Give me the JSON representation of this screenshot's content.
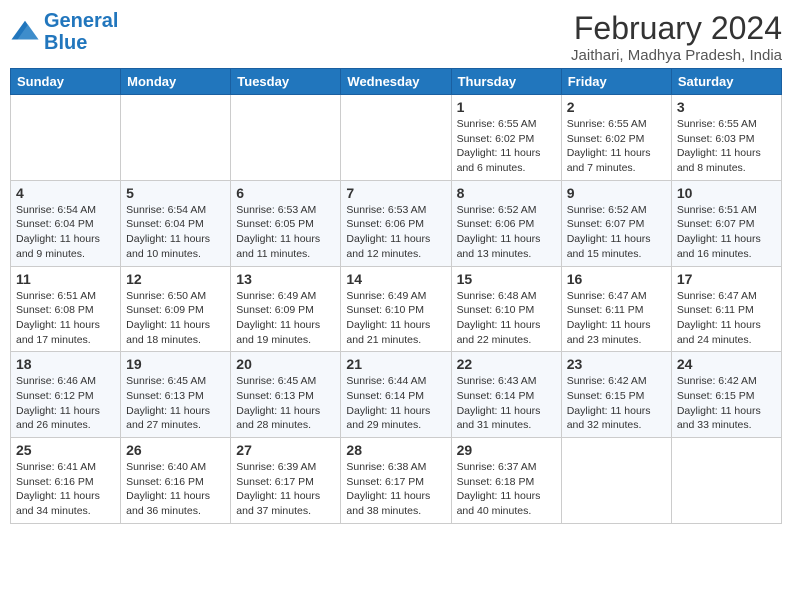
{
  "logo": {
    "line1": "General",
    "line2": "Blue"
  },
  "title": "February 2024",
  "location": "Jaithari, Madhya Pradesh, India",
  "days_of_week": [
    "Sunday",
    "Monday",
    "Tuesday",
    "Wednesday",
    "Thursday",
    "Friday",
    "Saturday"
  ],
  "weeks": [
    [
      {
        "day": "",
        "info": ""
      },
      {
        "day": "",
        "info": ""
      },
      {
        "day": "",
        "info": ""
      },
      {
        "day": "",
        "info": ""
      },
      {
        "day": "1",
        "info": "Sunrise: 6:55 AM\nSunset: 6:02 PM\nDaylight: 11 hours\nand 6 minutes."
      },
      {
        "day": "2",
        "info": "Sunrise: 6:55 AM\nSunset: 6:02 PM\nDaylight: 11 hours\nand 7 minutes."
      },
      {
        "day": "3",
        "info": "Sunrise: 6:55 AM\nSunset: 6:03 PM\nDaylight: 11 hours\nand 8 minutes."
      }
    ],
    [
      {
        "day": "4",
        "info": "Sunrise: 6:54 AM\nSunset: 6:04 PM\nDaylight: 11 hours\nand 9 minutes."
      },
      {
        "day": "5",
        "info": "Sunrise: 6:54 AM\nSunset: 6:04 PM\nDaylight: 11 hours\nand 10 minutes."
      },
      {
        "day": "6",
        "info": "Sunrise: 6:53 AM\nSunset: 6:05 PM\nDaylight: 11 hours\nand 11 minutes."
      },
      {
        "day": "7",
        "info": "Sunrise: 6:53 AM\nSunset: 6:06 PM\nDaylight: 11 hours\nand 12 minutes."
      },
      {
        "day": "8",
        "info": "Sunrise: 6:52 AM\nSunset: 6:06 PM\nDaylight: 11 hours\nand 13 minutes."
      },
      {
        "day": "9",
        "info": "Sunrise: 6:52 AM\nSunset: 6:07 PM\nDaylight: 11 hours\nand 15 minutes."
      },
      {
        "day": "10",
        "info": "Sunrise: 6:51 AM\nSunset: 6:07 PM\nDaylight: 11 hours\nand 16 minutes."
      }
    ],
    [
      {
        "day": "11",
        "info": "Sunrise: 6:51 AM\nSunset: 6:08 PM\nDaylight: 11 hours\nand 17 minutes."
      },
      {
        "day": "12",
        "info": "Sunrise: 6:50 AM\nSunset: 6:09 PM\nDaylight: 11 hours\nand 18 minutes."
      },
      {
        "day": "13",
        "info": "Sunrise: 6:49 AM\nSunset: 6:09 PM\nDaylight: 11 hours\nand 19 minutes."
      },
      {
        "day": "14",
        "info": "Sunrise: 6:49 AM\nSunset: 6:10 PM\nDaylight: 11 hours\nand 21 minutes."
      },
      {
        "day": "15",
        "info": "Sunrise: 6:48 AM\nSunset: 6:10 PM\nDaylight: 11 hours\nand 22 minutes."
      },
      {
        "day": "16",
        "info": "Sunrise: 6:47 AM\nSunset: 6:11 PM\nDaylight: 11 hours\nand 23 minutes."
      },
      {
        "day": "17",
        "info": "Sunrise: 6:47 AM\nSunset: 6:11 PM\nDaylight: 11 hours\nand 24 minutes."
      }
    ],
    [
      {
        "day": "18",
        "info": "Sunrise: 6:46 AM\nSunset: 6:12 PM\nDaylight: 11 hours\nand 26 minutes."
      },
      {
        "day": "19",
        "info": "Sunrise: 6:45 AM\nSunset: 6:13 PM\nDaylight: 11 hours\nand 27 minutes."
      },
      {
        "day": "20",
        "info": "Sunrise: 6:45 AM\nSunset: 6:13 PM\nDaylight: 11 hours\nand 28 minutes."
      },
      {
        "day": "21",
        "info": "Sunrise: 6:44 AM\nSunset: 6:14 PM\nDaylight: 11 hours\nand 29 minutes."
      },
      {
        "day": "22",
        "info": "Sunrise: 6:43 AM\nSunset: 6:14 PM\nDaylight: 11 hours\nand 31 minutes."
      },
      {
        "day": "23",
        "info": "Sunrise: 6:42 AM\nSunset: 6:15 PM\nDaylight: 11 hours\nand 32 minutes."
      },
      {
        "day": "24",
        "info": "Sunrise: 6:42 AM\nSunset: 6:15 PM\nDaylight: 11 hours\nand 33 minutes."
      }
    ],
    [
      {
        "day": "25",
        "info": "Sunrise: 6:41 AM\nSunset: 6:16 PM\nDaylight: 11 hours\nand 34 minutes."
      },
      {
        "day": "26",
        "info": "Sunrise: 6:40 AM\nSunset: 6:16 PM\nDaylight: 11 hours\nand 36 minutes."
      },
      {
        "day": "27",
        "info": "Sunrise: 6:39 AM\nSunset: 6:17 PM\nDaylight: 11 hours\nand 37 minutes."
      },
      {
        "day": "28",
        "info": "Sunrise: 6:38 AM\nSunset: 6:17 PM\nDaylight: 11 hours\nand 38 minutes."
      },
      {
        "day": "29",
        "info": "Sunrise: 6:37 AM\nSunset: 6:18 PM\nDaylight: 11 hours\nand 40 minutes."
      },
      {
        "day": "",
        "info": ""
      },
      {
        "day": "",
        "info": ""
      }
    ]
  ]
}
